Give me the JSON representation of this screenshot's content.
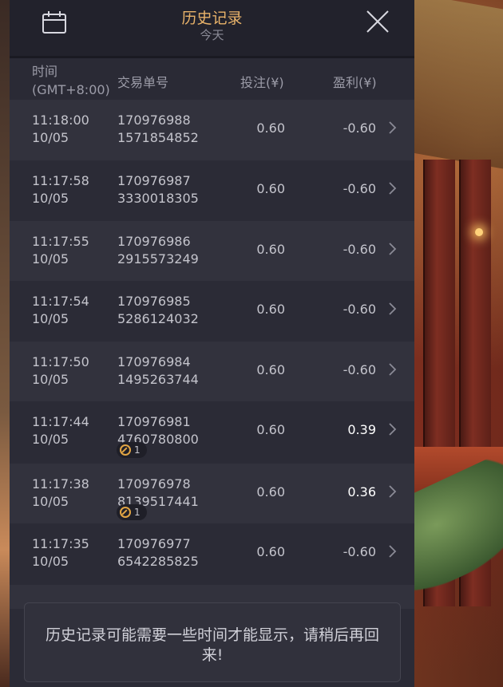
{
  "header": {
    "title": "历史记录",
    "subtitle": "今天"
  },
  "columns": {
    "time_line1": "时间",
    "time_line2": "(GMT+8:00)",
    "order": "交易单号",
    "bet": "投注(¥)",
    "profit": "盈利(¥)"
  },
  "rows": [
    {
      "time": "11:18:00",
      "date": "10/05",
      "order1": "170976988",
      "order2": "1571854852",
      "bet": "0.60",
      "profit": "-0.60",
      "badge": ""
    },
    {
      "time": "11:17:58",
      "date": "10/05",
      "order1": "170976987",
      "order2": "3330018305",
      "bet": "0.60",
      "profit": "-0.60",
      "badge": ""
    },
    {
      "time": "11:17:55",
      "date": "10/05",
      "order1": "170976986",
      "order2": "2915573249",
      "bet": "0.60",
      "profit": "-0.60",
      "badge": ""
    },
    {
      "time": "11:17:54",
      "date": "10/05",
      "order1": "170976985",
      "order2": "5286124032",
      "bet": "0.60",
      "profit": "-0.60",
      "badge": ""
    },
    {
      "time": "11:17:50",
      "date": "10/05",
      "order1": "170976984",
      "order2": "1495263744",
      "bet": "0.60",
      "profit": "-0.60",
      "badge": ""
    },
    {
      "time": "11:17:44",
      "date": "10/05",
      "order1": "170976981",
      "order2": "4760780800",
      "bet": "0.60",
      "profit": "0.39",
      "badge": "1"
    },
    {
      "time": "11:17:38",
      "date": "10/05",
      "order1": "170976978",
      "order2": "8139517441",
      "bet": "0.60",
      "profit": "0.36",
      "badge": "1"
    },
    {
      "time": "11:17:35",
      "date": "10/05",
      "order1": "170976977",
      "order2": "6542285825",
      "bet": "0.60",
      "profit": "-0.60",
      "badge": ""
    }
  ],
  "toast": {
    "message": "历史记录可能需要一些时间才能显示，请稍后再回来!"
  },
  "colors": {
    "accent": "#e9b36a",
    "panel": "#2b2b36",
    "row_alt": "#32323d"
  },
  "icons": {
    "calendar": "calendar-icon",
    "close": "close-icon",
    "chevron": "chevron-right-icon",
    "bonus": "coin-icon"
  }
}
